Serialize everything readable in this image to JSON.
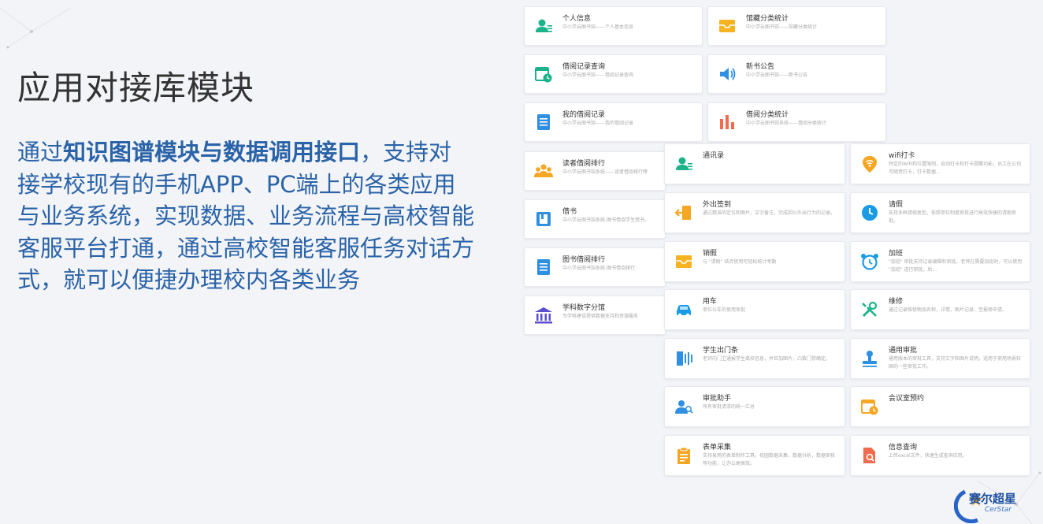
{
  "page": {
    "title": "应用对接库模块",
    "desc_lead": "通过",
    "desc_bold": "知识图谱模块与数据调用接口",
    "desc_rest": "，支持对接学校现有的手机APP、PC端上的各类应用与业务系统，实现数据、业务流程与高校智能客服平台打通，通过高校智能客服任务对话方式，就可以便捷办理校内各类业务"
  },
  "cards": [
    {
      "name": "personal-info",
      "title": "个人信息",
      "sub": "中小学云图书馆——个人基本信息",
      "icon": "user-card-icon",
      "color": "#1bb38a"
    },
    {
      "name": "collection-stats",
      "title": "馆藏分类统计",
      "sub": "中小学云图书馆——馆藏分类统计",
      "icon": "inbox-icon",
      "color": "#f5b320"
    },
    {
      "name": "borrow-query",
      "title": "借阅记录查询",
      "sub": "中小学云图书馆——借阅记录查询",
      "icon": "calendar-clock-icon",
      "color": "#1bb38a"
    },
    {
      "name": "new-books",
      "title": "新书公告",
      "sub": "中小学云图书馆——新书公告",
      "icon": "speaker-icon",
      "color": "#2f8fe0"
    },
    {
      "name": "my-borrow",
      "title": "我的借阅记录",
      "sub": "中小学云图书馆——我的借阅记录",
      "icon": "document-icon",
      "color": "#2f8fe0"
    },
    {
      "name": "borrow-stats",
      "title": "借阅分类统计",
      "sub": "中小学云图书馆系统——借阅分类统计",
      "icon": "bar-chart-icon",
      "color": "#f26b4f"
    },
    {
      "name": "reader-rank",
      "title": "读者借阅排行",
      "sub": "中小学云图书馆系统——读者借阅排行榜",
      "icon": "group-icon",
      "color": "#f5a623"
    },
    {
      "name": "borrow-book",
      "title": "借书",
      "sub": "中小学云图书馆系统-图书借阅学生借书。",
      "icon": "book-icon",
      "color": "#2f8fe0"
    },
    {
      "name": "book-rank",
      "title": "图书借阅排行",
      "sub": "中小学云图书馆系统-图书借阅排行",
      "icon": "document-icon",
      "color": "#2f8fe0"
    },
    {
      "name": "subject-digital",
      "title": "学科数字分馆",
      "sub": "为学科建设提供数据支持和资源服务",
      "icon": "bank-icon",
      "color": "#5a4fcf"
    },
    {
      "name": "contacts",
      "title": "通讯录",
      "sub": "",
      "icon": "user-card-icon",
      "color": "#1bb38a"
    },
    {
      "name": "wifi-checkin",
      "title": "wifi打卡",
      "sub": "特定的WiFi和位置限制，自动打卡和打卡提醒功能，员工在公司可随意打卡，打卡数据…",
      "icon": "location-wifi-icon",
      "color": "#f5a623"
    },
    {
      "name": "outing-sign",
      "title": "外出签到",
      "sub": "通过精准的定位和图片，文字备注，完成因公外出行为的记录。",
      "icon": "exit-icon",
      "color": "#f5a623"
    },
    {
      "name": "leave",
      "title": "请假",
      "sub": "支持多种请假类型，依照单位制度审批进行高效快捷的请假审批。",
      "icon": "clock-icon",
      "color": "#1a9be6"
    },
    {
      "name": "cancel-leave",
      "title": "销假",
      "sub": "与 \"请假\" 结合使用可轻松统计考勤",
      "icon": "inbox-icon",
      "color": "#f5b320"
    },
    {
      "name": "overtime",
      "title": "加班",
      "sub": "\"加班\" 审批支持记录编辑和审批。老师在需要加班时，可以使用 \"加班\" 进行审批，后…",
      "icon": "alarm-icon",
      "color": "#1a9be6"
    },
    {
      "name": "vehicle",
      "title": "用车",
      "sub": "单位公车的使用审批",
      "icon": "car-icon",
      "color": "#1a9be6"
    },
    {
      "name": "repair",
      "title": "维修",
      "sub": "通过记录维修物品名称，详情，图片记录，至报修申请。",
      "icon": "tools-icon",
      "color": "#1bb38a"
    },
    {
      "name": "student-exit",
      "title": "学生出门条",
      "sub": "老师向门卫通报学生离校信息，并且加图片，凸数门禁确定。",
      "icon": "door-icon",
      "color": "#2f8fe0"
    },
    {
      "name": "general-approval",
      "title": "通用审批",
      "sub": "通用版本的审批工具，支持文字和图片说明，适用于使用场景较固的一些审批工作。",
      "icon": "stamp-icon",
      "color": "#2f8fe0"
    },
    {
      "name": "approval-assistant",
      "title": "审批助手",
      "sub": "所有审批请求的统一汇总",
      "icon": "users-icon",
      "color": "#2f8fe0"
    },
    {
      "name": "meeting-booking",
      "title": "会议室预约",
      "sub": "",
      "icon": "calendar-clock-icon",
      "color": "#f5a623"
    },
    {
      "name": "form-collect",
      "title": "表单采集",
      "sub": "支持易用的表单制作工具，校园数据采集，数据分析，数据审核等功能，让办公更高效。",
      "icon": "clipboard-icon",
      "color": "#f5a623"
    },
    {
      "name": "info-query",
      "title": "信息查询",
      "sub": "上传excel文件，快速生成查询应用。",
      "icon": "search-doc-icon",
      "color": "#f26b4f"
    }
  ],
  "logo": {
    "name": "赛尔超星",
    "en": "CerStar"
  }
}
